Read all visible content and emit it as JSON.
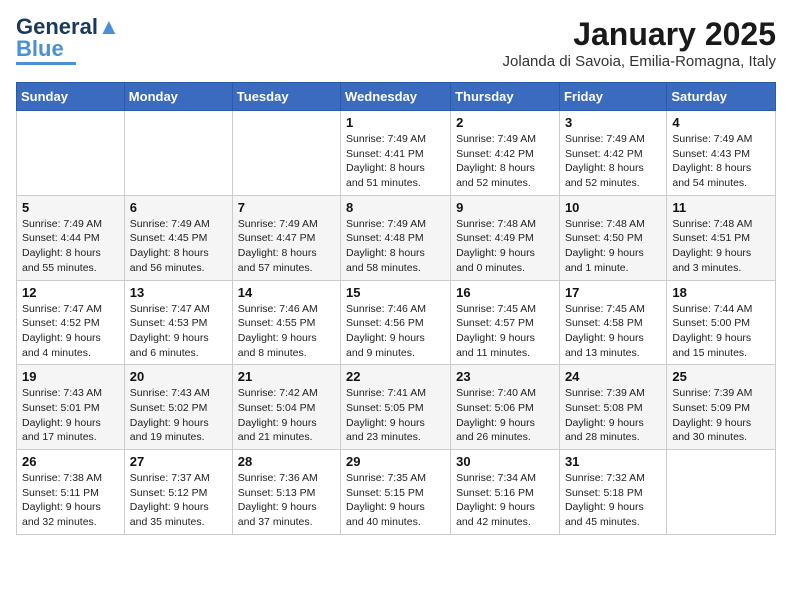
{
  "logo": {
    "general": "General",
    "blue": "Blue"
  },
  "header": {
    "month": "January 2025",
    "location": "Jolanda di Savoia, Emilia-Romagna, Italy"
  },
  "weekdays": [
    "Sunday",
    "Monday",
    "Tuesday",
    "Wednesday",
    "Thursday",
    "Friday",
    "Saturday"
  ],
  "weeks": [
    [
      {
        "day": "",
        "info": ""
      },
      {
        "day": "",
        "info": ""
      },
      {
        "day": "",
        "info": ""
      },
      {
        "day": "1",
        "info": "Sunrise: 7:49 AM\nSunset: 4:41 PM\nDaylight: 8 hours and 51 minutes."
      },
      {
        "day": "2",
        "info": "Sunrise: 7:49 AM\nSunset: 4:42 PM\nDaylight: 8 hours and 52 minutes."
      },
      {
        "day": "3",
        "info": "Sunrise: 7:49 AM\nSunset: 4:42 PM\nDaylight: 8 hours and 52 minutes."
      },
      {
        "day": "4",
        "info": "Sunrise: 7:49 AM\nSunset: 4:43 PM\nDaylight: 8 hours and 54 minutes."
      }
    ],
    [
      {
        "day": "5",
        "info": "Sunrise: 7:49 AM\nSunset: 4:44 PM\nDaylight: 8 hours and 55 minutes."
      },
      {
        "day": "6",
        "info": "Sunrise: 7:49 AM\nSunset: 4:45 PM\nDaylight: 8 hours and 56 minutes."
      },
      {
        "day": "7",
        "info": "Sunrise: 7:49 AM\nSunset: 4:47 PM\nDaylight: 8 hours and 57 minutes."
      },
      {
        "day": "8",
        "info": "Sunrise: 7:49 AM\nSunset: 4:48 PM\nDaylight: 8 hours and 58 minutes."
      },
      {
        "day": "9",
        "info": "Sunrise: 7:48 AM\nSunset: 4:49 PM\nDaylight: 9 hours and 0 minutes."
      },
      {
        "day": "10",
        "info": "Sunrise: 7:48 AM\nSunset: 4:50 PM\nDaylight: 9 hours and 1 minute."
      },
      {
        "day": "11",
        "info": "Sunrise: 7:48 AM\nSunset: 4:51 PM\nDaylight: 9 hours and 3 minutes."
      }
    ],
    [
      {
        "day": "12",
        "info": "Sunrise: 7:47 AM\nSunset: 4:52 PM\nDaylight: 9 hours and 4 minutes."
      },
      {
        "day": "13",
        "info": "Sunrise: 7:47 AM\nSunset: 4:53 PM\nDaylight: 9 hours and 6 minutes."
      },
      {
        "day": "14",
        "info": "Sunrise: 7:46 AM\nSunset: 4:55 PM\nDaylight: 9 hours and 8 minutes."
      },
      {
        "day": "15",
        "info": "Sunrise: 7:46 AM\nSunset: 4:56 PM\nDaylight: 9 hours and 9 minutes."
      },
      {
        "day": "16",
        "info": "Sunrise: 7:45 AM\nSunset: 4:57 PM\nDaylight: 9 hours and 11 minutes."
      },
      {
        "day": "17",
        "info": "Sunrise: 7:45 AM\nSunset: 4:58 PM\nDaylight: 9 hours and 13 minutes."
      },
      {
        "day": "18",
        "info": "Sunrise: 7:44 AM\nSunset: 5:00 PM\nDaylight: 9 hours and 15 minutes."
      }
    ],
    [
      {
        "day": "19",
        "info": "Sunrise: 7:43 AM\nSunset: 5:01 PM\nDaylight: 9 hours and 17 minutes."
      },
      {
        "day": "20",
        "info": "Sunrise: 7:43 AM\nSunset: 5:02 PM\nDaylight: 9 hours and 19 minutes."
      },
      {
        "day": "21",
        "info": "Sunrise: 7:42 AM\nSunset: 5:04 PM\nDaylight: 9 hours and 21 minutes."
      },
      {
        "day": "22",
        "info": "Sunrise: 7:41 AM\nSunset: 5:05 PM\nDaylight: 9 hours and 23 minutes."
      },
      {
        "day": "23",
        "info": "Sunrise: 7:40 AM\nSunset: 5:06 PM\nDaylight: 9 hours and 26 minutes."
      },
      {
        "day": "24",
        "info": "Sunrise: 7:39 AM\nSunset: 5:08 PM\nDaylight: 9 hours and 28 minutes."
      },
      {
        "day": "25",
        "info": "Sunrise: 7:39 AM\nSunset: 5:09 PM\nDaylight: 9 hours and 30 minutes."
      }
    ],
    [
      {
        "day": "26",
        "info": "Sunrise: 7:38 AM\nSunset: 5:11 PM\nDaylight: 9 hours and 32 minutes."
      },
      {
        "day": "27",
        "info": "Sunrise: 7:37 AM\nSunset: 5:12 PM\nDaylight: 9 hours and 35 minutes."
      },
      {
        "day": "28",
        "info": "Sunrise: 7:36 AM\nSunset: 5:13 PM\nDaylight: 9 hours and 37 minutes."
      },
      {
        "day": "29",
        "info": "Sunrise: 7:35 AM\nSunset: 5:15 PM\nDaylight: 9 hours and 40 minutes."
      },
      {
        "day": "30",
        "info": "Sunrise: 7:34 AM\nSunset: 5:16 PM\nDaylight: 9 hours and 42 minutes."
      },
      {
        "day": "31",
        "info": "Sunrise: 7:32 AM\nSunset: 5:18 PM\nDaylight: 9 hours and 45 minutes."
      },
      {
        "day": "",
        "info": ""
      }
    ]
  ]
}
